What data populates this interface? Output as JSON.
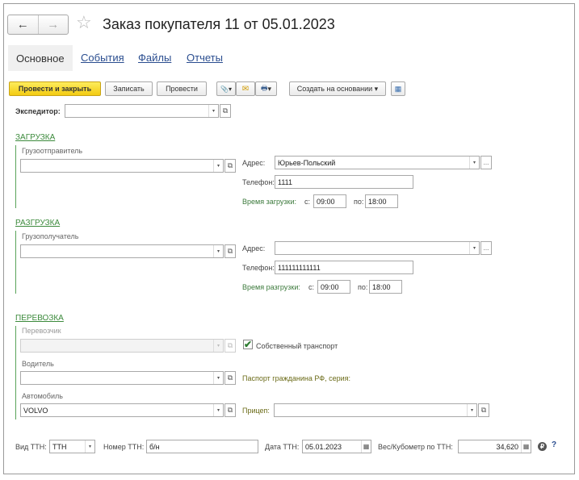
{
  "header": {
    "back_icon": "←",
    "forward_icon": "→",
    "favorite_icon": "☆",
    "title": "Заказ покупателя 11 от 05.01.2023"
  },
  "tabs": [
    {
      "label": "Основное",
      "active": true
    },
    {
      "label": "События"
    },
    {
      "label": "Файлы"
    },
    {
      "label": "Отчеты"
    }
  ],
  "toolbar": {
    "post_close": "Провести и закрыть",
    "save": "Записать",
    "post": "Провести",
    "create_based": "Создать на основании",
    "create_based_arrow": "▾",
    "attach_icon": "📎",
    "mail_icon": "✉",
    "print_icon": "🖶",
    "table_icon": "▦",
    "dd_arrow": "▾"
  },
  "expeditor": {
    "label": "Экспедитор:",
    "value": ""
  },
  "loading": {
    "section": "ЗАГРУЗКА",
    "shipper_label": "Грузоотправитель",
    "shipper_value": "",
    "address_label": "Адрес:",
    "address_value": "Юрьев-Польский",
    "phone_label": "Телефон:",
    "phone_value": "1111",
    "time_label": "Время загрузки:",
    "from_label": "с:",
    "from_value": "09:00",
    "to_label": "по:",
    "to_value": "18:00"
  },
  "unloading": {
    "section": "РАЗГРУЗКА",
    "consignee_label": "Грузополучатель",
    "consignee_value": "",
    "address_label": "Адрес:",
    "address_value": "",
    "phone_label": "Телефон:",
    "phone_value": "111111111111",
    "time_label": "Время разгрузки:",
    "from_label": "с:",
    "from_value": "09:00",
    "to_label": "по:",
    "to_value": "18:00"
  },
  "transport": {
    "section": "ПЕРЕВОЗКА",
    "carrier_label": "Перевозчик",
    "carrier_value": "",
    "own_transport_label": "Собственный транспорт",
    "own_transport_checked": true,
    "check_mark": "✔",
    "driver_label": "Водитель",
    "driver_value": "",
    "passport_label": "Паспорт гражданина РФ, серия:",
    "car_label": "Автомобиль",
    "car_value": "VOLVO",
    "trailer_label": "Прицеп:",
    "trailer_value": ""
  },
  "footer": {
    "ttn_type_label": "Вид ТТН:",
    "ttn_type_value": "ТТН",
    "ttn_number_label": "Номер ТТН:",
    "ttn_number_value": "б/н",
    "ttn_date_label": "Дата ТТН:",
    "ttn_date_value": "05.01.2023",
    "weight_label": "Вес/Кубометр по ТТН:",
    "weight_value": "34,620",
    "calc_icon": "▦",
    "calendar_icon": "▦",
    "info_icon": "₽",
    "help_icon": "?"
  },
  "icons": {
    "dropdown": "▾",
    "open": "⧉",
    "dots": "..."
  }
}
